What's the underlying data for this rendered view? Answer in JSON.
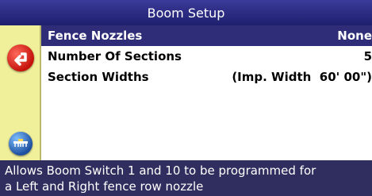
{
  "header": {
    "title": "Boom Setup"
  },
  "menu": {
    "items": [
      {
        "label": "Fence Nozzles",
        "value": "None",
        "selected": true
      },
      {
        "label": "Number Of Sections",
        "value": "5"
      },
      {
        "label": "Section Widths",
        "value": "(Imp. Width  60' 00\")"
      }
    ]
  },
  "footer": {
    "line1": "Allows Boom Switch 1 and 10 to be programmed for",
    "line2": "a Left and Right fence row nozzle"
  },
  "icons": {
    "back": "back-arrow-icon",
    "setup": "boom-setup-icon"
  },
  "colors": {
    "title_bar": "#2a2a80",
    "selected_row": "#2f2d78",
    "left_panel": "#f0ef9a",
    "footer": "#2f2e5e",
    "back_button": "#d8261c"
  }
}
